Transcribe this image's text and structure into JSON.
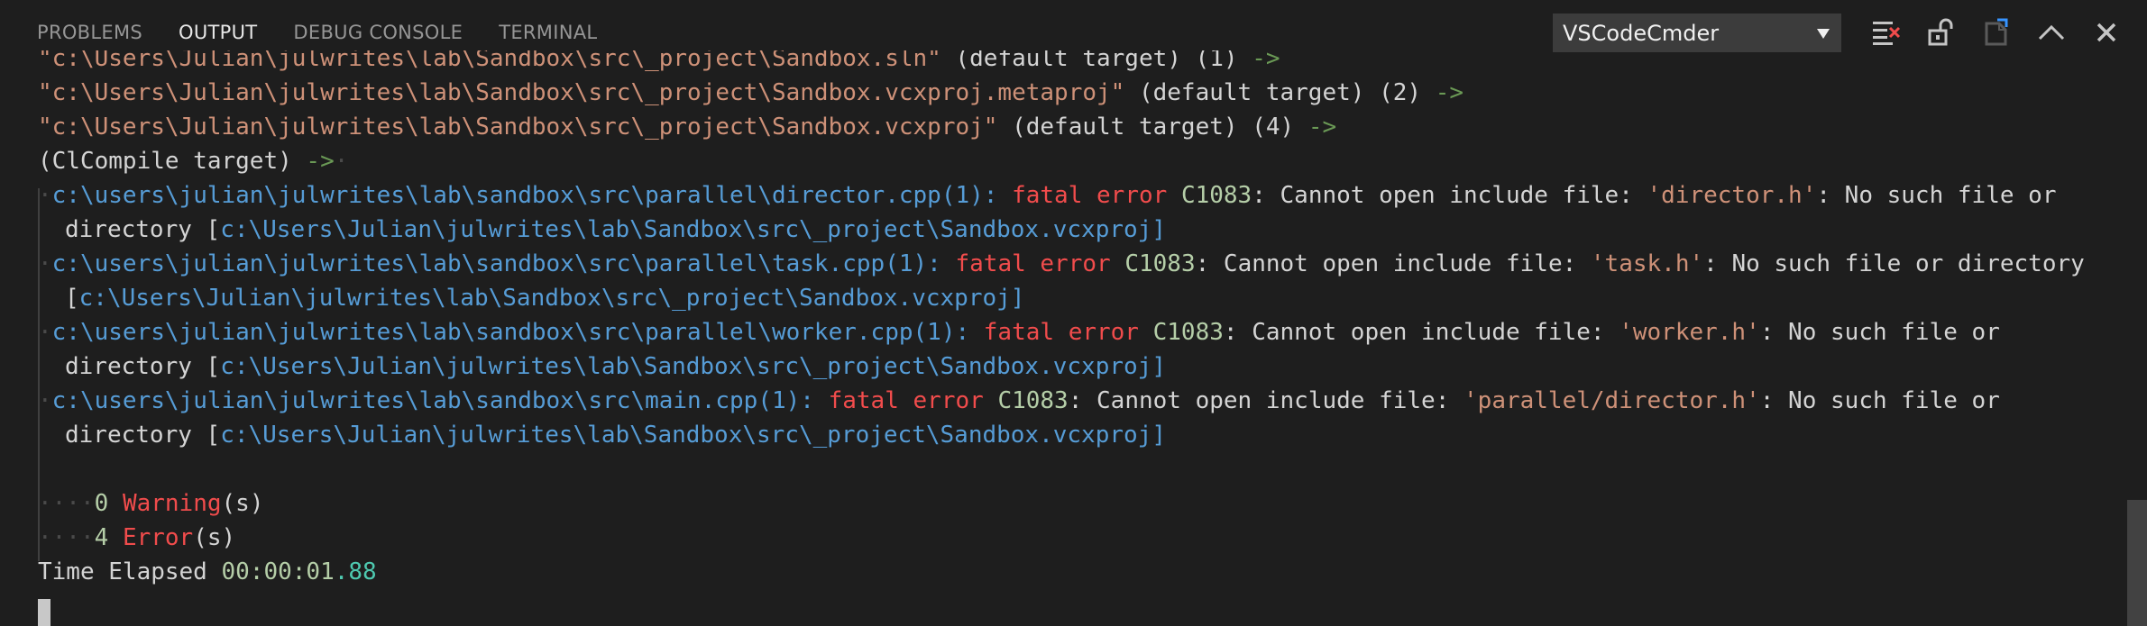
{
  "panel": {
    "tabs": [
      {
        "label": "PROBLEMS"
      },
      {
        "label": "OUTPUT"
      },
      {
        "label": "DEBUG CONSOLE"
      },
      {
        "label": "TERMINAL"
      }
    ],
    "active_tab": "OUTPUT",
    "channel_select": {
      "selected": "VSCodeCmder"
    },
    "actions": [
      {
        "icon": "clear-output-icon"
      },
      {
        "icon": "lock-scroll-icon"
      },
      {
        "icon": "open-log-file-icon"
      },
      {
        "icon": "maximize-panel-icon"
      },
      {
        "icon": "close-panel-icon"
      }
    ]
  },
  "output": {
    "lines": [
      [
        {
          "t": "\"c:\\Users\\Julian\\julwrites\\lab\\Sandbox\\src\\_project\\Sandbox.sln\"",
          "c": "path"
        },
        {
          "t": " (default target) (1) ",
          "c": "text"
        },
        {
          "t": "->",
          "c": "arrow"
        }
      ],
      [
        {
          "t": "\"c:\\Users\\Julian\\julwrites\\lab\\Sandbox\\src\\_project\\Sandbox.vcxproj.metaproj\"",
          "c": "path"
        },
        {
          "t": " (default target) (2) ",
          "c": "text"
        },
        {
          "t": "->",
          "c": "arrow"
        }
      ],
      [
        {
          "t": "\"c:\\Users\\Julian\\julwrites\\lab\\Sandbox\\src\\_project\\Sandbox.vcxproj\"",
          "c": "path"
        },
        {
          "t": " (default target) (4) ",
          "c": "text"
        },
        {
          "t": "->",
          "c": "arrow"
        }
      ],
      [
        {
          "t": "(ClCompile target) ",
          "c": "text"
        },
        {
          "t": "->",
          "c": "arrow"
        },
        {
          "t": "·",
          "c": "dot"
        }
      ],
      [
        {
          "t": "·",
          "c": "dot"
        },
        {
          "t": "c:\\users\\julian\\julwrites\\lab\\sandbox\\src\\parallel\\director.cpp(1):",
          "c": "blue"
        },
        {
          "t": " fatal error ",
          "c": "red"
        },
        {
          "t": "C1083",
          "c": "green"
        },
        {
          "t": ": Cannot open include file: ",
          "c": "text"
        },
        {
          "t": "'director.h'",
          "c": "path"
        },
        {
          "t": ": No such file or",
          "c": "text"
        }
      ],
      [
        {
          "t": "directory [",
          "c": "text"
        },
        {
          "t": "c:\\Users\\Julian\\julwrites\\lab\\Sandbox\\src\\_project\\Sandbox.vcxproj",
          "c": "blue"
        },
        {
          "t": "]",
          "c": "blue"
        }
      ],
      [
        {
          "t": "·",
          "c": "dot"
        },
        {
          "t": "c:\\users\\julian\\julwrites\\lab\\sandbox\\src\\parallel\\task.cpp(1):",
          "c": "blue"
        },
        {
          "t": " fatal error ",
          "c": "red"
        },
        {
          "t": "C1083",
          "c": "green"
        },
        {
          "t": ": Cannot open include file: ",
          "c": "text"
        },
        {
          "t": "'task.h'",
          "c": "path"
        },
        {
          "t": ": No such file or directory",
          "c": "text"
        }
      ],
      [
        {
          "t": "[",
          "c": "text"
        },
        {
          "t": "c:\\Users\\Julian\\julwrites\\lab\\Sandbox\\src\\_project\\Sandbox.vcxproj",
          "c": "blue"
        },
        {
          "t": "]",
          "c": "blue"
        }
      ],
      [
        {
          "t": "·",
          "c": "dot"
        },
        {
          "t": "c:\\users\\julian\\julwrites\\lab\\sandbox\\src\\parallel\\worker.cpp(1):",
          "c": "blue"
        },
        {
          "t": " fatal error ",
          "c": "red"
        },
        {
          "t": "C1083",
          "c": "green"
        },
        {
          "t": ": Cannot open include file: ",
          "c": "text"
        },
        {
          "t": "'worker.h'",
          "c": "path"
        },
        {
          "t": ": No such file or",
          "c": "text"
        }
      ],
      [
        {
          "t": "directory [",
          "c": "text"
        },
        {
          "t": "c:\\Users\\Julian\\julwrites\\lab\\Sandbox\\src\\_project\\Sandbox.vcxproj",
          "c": "blue"
        },
        {
          "t": "]",
          "c": "blue"
        }
      ],
      [
        {
          "t": "·",
          "c": "dot"
        },
        {
          "t": "c:\\users\\julian\\julwrites\\lab\\sandbox\\src\\main.cpp(1):",
          "c": "blue"
        },
        {
          "t": " fatal error ",
          "c": "red"
        },
        {
          "t": "C1083",
          "c": "green"
        },
        {
          "t": ": Cannot open include file: ",
          "c": "text"
        },
        {
          "t": "'parallel/director.h'",
          "c": "path"
        },
        {
          "t": ": No such file or",
          "c": "text"
        }
      ],
      [
        {
          "t": "directory [",
          "c": "text"
        },
        {
          "t": "c:\\Users\\Julian\\julwrites\\lab\\Sandbox\\src\\_project\\Sandbox.vcxproj",
          "c": "blue"
        },
        {
          "t": "]",
          "c": "blue"
        }
      ],
      [],
      [
        {
          "t": "····",
          "c": "dot"
        },
        {
          "t": "0 ",
          "c": "green"
        },
        {
          "t": "Warning",
          "c": "red"
        },
        {
          "t": "(s)",
          "c": "text"
        }
      ],
      [
        {
          "t": "····",
          "c": "dot"
        },
        {
          "t": "4 ",
          "c": "green"
        },
        {
          "t": "Error",
          "c": "red"
        },
        {
          "t": "(s)",
          "c": "text"
        }
      ],
      [
        {
          "t": "Time Elapsed ",
          "c": "text"
        },
        {
          "t": "00:00:01",
          "c": "green"
        },
        {
          "t": ".88",
          "c": "teal"
        }
      ]
    ]
  },
  "colors": {
    "background": "#1e1e1e",
    "path": "#ce9178",
    "link": "#569cd6",
    "error": "#f14c4c",
    "number": "#b5cea8",
    "arrow": "#6a9955"
  }
}
